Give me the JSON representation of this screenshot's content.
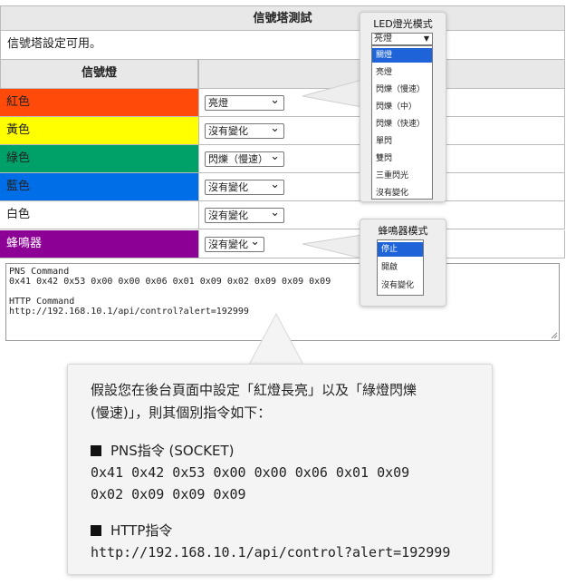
{
  "panel": {
    "title": "信號塔測試",
    "availability": "信號塔設定可用。",
    "col_light": "信號燈",
    "rows": [
      {
        "name": "紅色",
        "value": "亮燈",
        "color": "#ff4a0a",
        "text_color": "#222222"
      },
      {
        "name": "黃色",
        "value": "沒有變化",
        "color": "#ffff00",
        "text_color": "#222222"
      },
      {
        "name": "綠色",
        "value": "閃爍（慢速）",
        "color": "#00a069",
        "text_color": "#222222"
      },
      {
        "name": "藍色",
        "value": "沒有變化",
        "color": "#006ee6",
        "text_color": "#222222"
      },
      {
        "name": "白色",
        "value": "沒有變化",
        "color": "#ffffff",
        "text_color": "#222222"
      },
      {
        "name": "蜂鳴器",
        "value": "沒有變化",
        "color": "#8c0096",
        "text_color": "#ffffff"
      }
    ],
    "command_text": "PNS Command\n0x41 0x42 0x53 0x00 0x00 0x06 0x01 0x09 0x02 0x09 0x09 0x09\n\nHTTP Command\nhttp://192.168.10.1/api/control?alert=192999"
  },
  "led_popup": {
    "title": "LED燈光模式",
    "selected": "亮燈",
    "options": [
      "關燈",
      "亮燈",
      "閃爍（慢速）",
      "閃爍（中）",
      "閃爍（快速）",
      "單閃",
      "雙閃",
      "三重閃光",
      "沒有變化"
    ],
    "highlighted_index": 0
  },
  "buzzer_popup": {
    "title": "蜂鳴器模式",
    "options": [
      "停止",
      "開啟",
      "沒有變化"
    ],
    "highlighted_index": 0
  },
  "callout": {
    "intro_line1": "假設您在後台頁面中設定「紅燈長亮」以及「綠燈閃爍",
    "intro_line2": "(慢速)」，則其個別指令如下：",
    "pns_heading": "PNS指令 (SOCKET)",
    "pns_line1": "0x41 0x42 0x53 0x00 0x00 0x06 0x01 0x09",
    "pns_line2": "0x02 0x09 0x09 0x09",
    "http_heading": "HTTP指令",
    "http_url": "http://192.168.10.1/api/control?alert=192999"
  },
  "colors": {
    "highlight": "#1e64d8",
    "header_bg": "#e8e8e8"
  }
}
